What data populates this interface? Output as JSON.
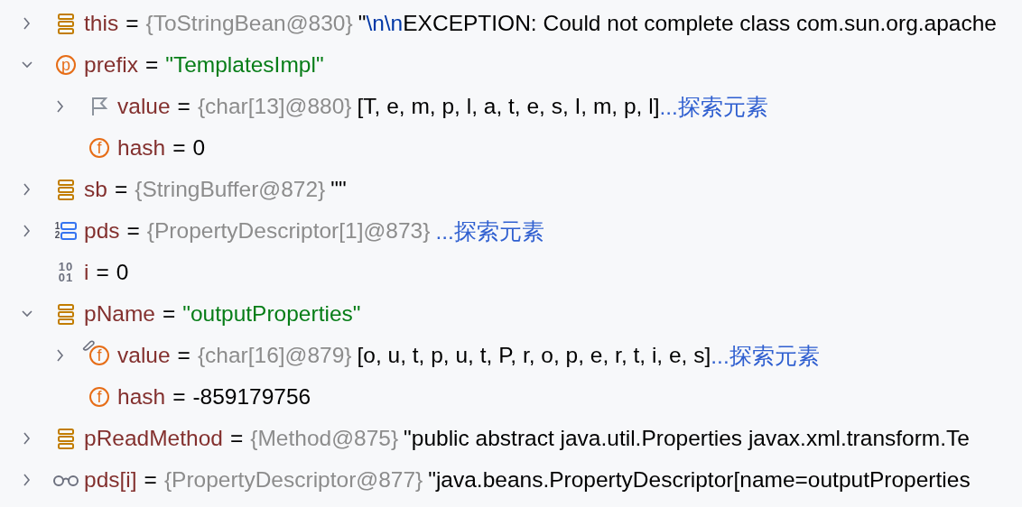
{
  "rows": [
    {
      "expanded": false,
      "icon": {
        "kind": "object"
      },
      "name": "this",
      "sep": "=",
      "parts": [
        {
          "kind": "type",
          "text": "{ToStringBean@830}"
        },
        {
          "kind": "plain",
          "text": "\""
        },
        {
          "kind": "escape",
          "text": "\\n\\n"
        },
        {
          "kind": "plain",
          "text": "EXCEPTION: Could not complete class com.sun.org.apache"
        }
      ]
    },
    {
      "expanded": true,
      "icon": {
        "kind": "circle",
        "glyph": "p"
      },
      "name": "prefix",
      "sep": "=",
      "parts": [
        {
          "kind": "string",
          "text": "\"TemplatesImpl\""
        }
      ],
      "children": [
        {
          "expanded": false,
          "icon": {
            "kind": "flag"
          },
          "name": "value",
          "sep": "=",
          "parts": [
            {
              "kind": "type",
              "text": "{char[13]@880}"
            },
            {
              "kind": "plain",
              "text": "[T, e, m, p, l, a, t, e, s, I, m, p, l]"
            },
            {
              "kind": "link",
              "text": "...探索元素"
            }
          ]
        },
        {
          "icon": {
            "kind": "circle",
            "glyph": "f"
          },
          "name": "hash",
          "sep": "=",
          "parts": [
            {
              "kind": "plain",
              "text": "0"
            }
          ]
        }
      ]
    },
    {
      "expanded": false,
      "icon": {
        "kind": "object"
      },
      "name": "sb",
      "sep": "=",
      "parts": [
        {
          "kind": "type",
          "text": "{StringBuffer@872}"
        },
        {
          "kind": "plain",
          "text": "\"\""
        }
      ]
    },
    {
      "expanded": false,
      "icon": {
        "kind": "array",
        "glyphs": [
          "1",
          "2"
        ]
      },
      "name": "pds",
      "sep": "=",
      "parts": [
        {
          "kind": "type",
          "text": "{PropertyDescriptor[1]@873}"
        },
        {
          "kind": "link",
          "text": "...探索元素"
        }
      ]
    },
    {
      "icon": {
        "kind": "binary",
        "glyphs": [
          "10",
          "01"
        ]
      },
      "name": "i",
      "sep": "=",
      "parts": [
        {
          "kind": "plain",
          "text": "0"
        }
      ]
    },
    {
      "expanded": true,
      "icon": {
        "kind": "object"
      },
      "name": "pName",
      "sep": "=",
      "parts": [
        {
          "kind": "string",
          "text": "\"outputProperties\""
        }
      ],
      "children": [
        {
          "expanded": false,
          "linked": true,
          "icon": {
            "kind": "circle",
            "glyph": "f"
          },
          "name": "value",
          "sep": "=",
          "parts": [
            {
              "kind": "type",
              "text": "{char[16]@879}"
            },
            {
              "kind": "plain",
              "text": "[o, u, t, p, u, t, P, r, o, p, e, r, t, i, e, s]"
            },
            {
              "kind": "link",
              "text": "...探索元素"
            }
          ]
        },
        {
          "icon": {
            "kind": "circle",
            "glyph": "f"
          },
          "name": "hash",
          "sep": "=",
          "parts": [
            {
              "kind": "plain",
              "text": "-859179756"
            }
          ]
        }
      ]
    },
    {
      "expanded": false,
      "icon": {
        "kind": "object"
      },
      "name": "pReadMethod",
      "sep": "=",
      "parts": [
        {
          "kind": "type",
          "text": "{Method@875}"
        },
        {
          "kind": "plain",
          "text": "\"public abstract java.util.Properties javax.xml.transform.Te"
        }
      ]
    },
    {
      "expanded": false,
      "icon": {
        "kind": "watch"
      },
      "name": "pds[i]",
      "sep": "=",
      "parts": [
        {
          "kind": "type",
          "text": "{PropertyDescriptor@877}"
        },
        {
          "kind": "plain",
          "text": "\"java.beans.PropertyDescriptor[name=outputProperties"
        }
      ]
    }
  ]
}
